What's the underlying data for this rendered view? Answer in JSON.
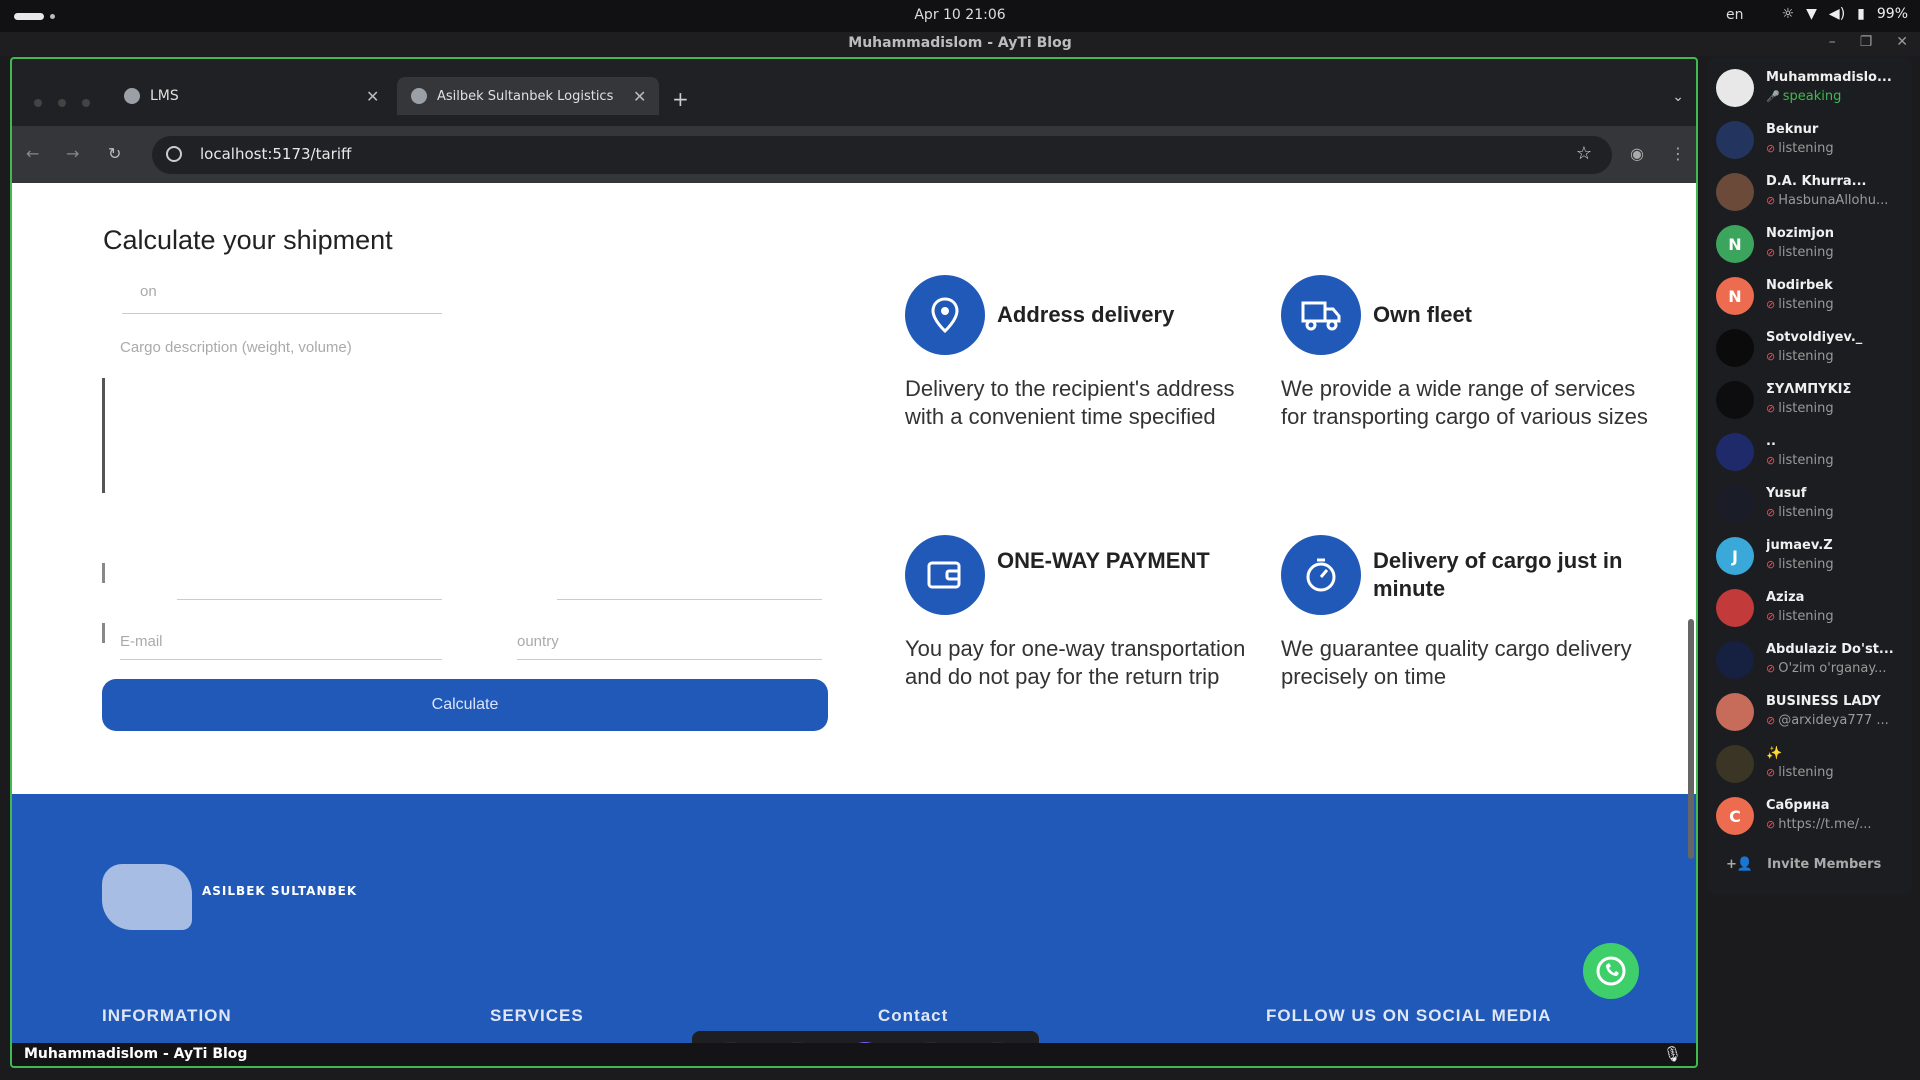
{
  "system": {
    "clock": "Apr 10  21:06",
    "lang": "en",
    "battery": "99%"
  },
  "window": {
    "title": "Muhammadislom - AyTi Blog"
  },
  "browser": {
    "tabs": [
      {
        "label": "LMS"
      },
      {
        "label": "Asilbek Sultanbek Logistics"
      }
    ],
    "url": "localhost:5173/tariff"
  },
  "page": {
    "calc_title": "Calculate your shipment",
    "placeholders": {
      "city": "on",
      "cargo": "Cargo description (weight, volume)",
      "email": "E-mail",
      "country": "ountry"
    },
    "calc_button": "Calculate",
    "features": [
      {
        "title": "Address delivery",
        "desc": "Delivery to the recipient's address with a convenient time specified",
        "icon": "location-pin-icon"
      },
      {
        "title": "Own fleet",
        "desc": "We provide a wide range of services for transporting cargo of various sizes",
        "icon": "truck-icon"
      },
      {
        "title": "ONE-WAY PAYMENT",
        "desc": "You pay for one-way transportation and do not pay for the return trip",
        "icon": "wallet-icon"
      },
      {
        "title": "Delivery of cargo just in minute",
        "desc": "We guarantee quality cargo delivery precisely on time",
        "icon": "stopwatch-icon"
      }
    ],
    "footer": {
      "logo_text": "ASILBEK SULTANBEK",
      "headings": [
        "INFORMATION",
        "SERVICES",
        "Contact",
        "FOLLOW US ON SOCIAL MEDIA"
      ]
    }
  },
  "stream": {
    "label": "Muhammadislom - AyTi Blog"
  },
  "members": [
    {
      "name": "Muhammadislo...",
      "status": "speaking",
      "speaking": true,
      "initial": "",
      "color": "#e8e8e8"
    },
    {
      "name": "Beknur",
      "status": "listening",
      "initial": "",
      "color": "#23345e"
    },
    {
      "name": "D.A. Khurra...",
      "status": "HasbunaAllohu...",
      "initial": "",
      "color": "#6b4a3a"
    },
    {
      "name": "Nozimjon",
      "status": "listening",
      "initial": "N",
      "color": "#3ba55d"
    },
    {
      "name": "Nodirbek",
      "status": "listening",
      "initial": "N",
      "color": "#ed6b4e"
    },
    {
      "name": "Sotvoldiyev._",
      "status": "listening",
      "initial": "",
      "color": "#0b0b0c"
    },
    {
      "name": "ΣΥΛΜΠΥΚΙΣ",
      "status": "listening",
      "initial": "",
      "color": "#0d0d0f"
    },
    {
      "name": "..",
      "status": "listening",
      "initial": "",
      "color": "#1f2a6b"
    },
    {
      "name": "Yusuf",
      "status": "listening",
      "initial": "",
      "color": "#1a1d28"
    },
    {
      "name": "jumaev.Z",
      "status": "listening",
      "initial": "J",
      "color": "#3aa8d8"
    },
    {
      "name": "Aziza",
      "status": "listening",
      "initial": "",
      "color": "#c23a3a"
    },
    {
      "name": "Abdulaziz Do'st...",
      "status": "O'zim o'rganay...",
      "initial": "",
      "color": "#162040"
    },
    {
      "name": "BUSINESS LADY",
      "status": "@arxideya777 ...",
      "initial": "",
      "color": "#c76b5a"
    },
    {
      "name": "✨",
      "status": "listening",
      "initial": "",
      "color": "#3a3524"
    },
    {
      "name": "Сабрина",
      "status": "https://t.me/...",
      "initial": "C",
      "color": "#ed6b4e"
    }
  ],
  "invite_label": "Invite Members"
}
